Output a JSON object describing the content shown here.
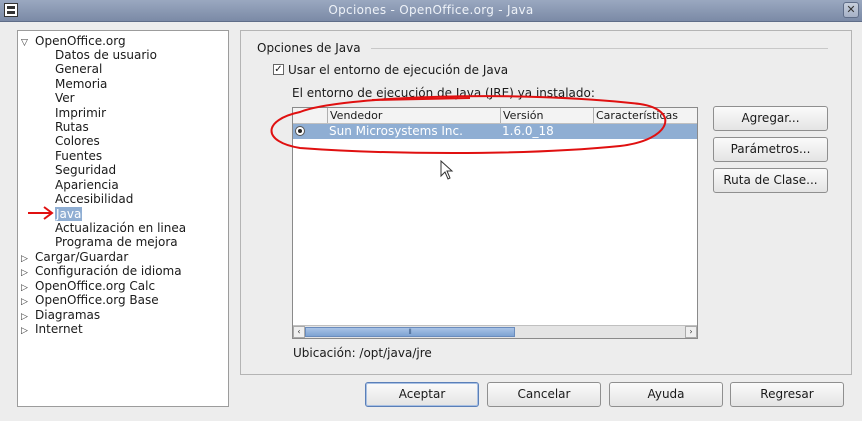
{
  "window": {
    "title": "Opciones - OpenOffice.org - Java",
    "close_glyph": "✕"
  },
  "tree": {
    "items": [
      {
        "label": "OpenOffice.org",
        "expander": "▽"
      },
      {
        "label": "Datos de usuario"
      },
      {
        "label": "General"
      },
      {
        "label": "Memoria"
      },
      {
        "label": "Ver"
      },
      {
        "label": "Imprimir"
      },
      {
        "label": "Rutas"
      },
      {
        "label": "Colores"
      },
      {
        "label": "Fuentes"
      },
      {
        "label": "Seguridad"
      },
      {
        "label": "Apariencia"
      },
      {
        "label": "Accesibilidad"
      },
      {
        "label": "Java",
        "selected": true
      },
      {
        "label": "Actualización en linea"
      },
      {
        "label": "Programa de mejora"
      },
      {
        "label": "Cargar/Guardar",
        "expander": "▷"
      },
      {
        "label": "Configuración de idioma",
        "expander": "▷"
      },
      {
        "label": "OpenOffice.org Calc",
        "expander": "▷"
      },
      {
        "label": "OpenOffice.org Base",
        "expander": "▷"
      },
      {
        "label": "Diagramas",
        "expander": "▷"
      },
      {
        "label": "Internet",
        "expander": "▷"
      }
    ]
  },
  "java": {
    "group_title": "Opciones de Java",
    "use_jre_label": "Usar el entorno de ejecución de Java",
    "use_jre_checked": true,
    "check_glyph": "✓",
    "installed_label": "El entorno de ejecución de Java (JRE) ya instalado:",
    "columns": [
      "Vendedor",
      "Versión",
      "Características"
    ],
    "rows": [
      {
        "vendor": "Sun Microsystems Inc.",
        "version": "1.6.0_18",
        "features": ""
      }
    ],
    "scroll_left": "‹",
    "scroll_right": "›",
    "scroll_grip": "⦀",
    "location_label": "Ubicación: /opt/java/jre"
  },
  "side_buttons": {
    "add": "Agregar...",
    "params": "Parámetros...",
    "classpath": "Ruta de Clase..."
  },
  "footer": {
    "ok": "Aceptar",
    "cancel": "Cancelar",
    "help": "Ayuda",
    "back": "Regresar"
  },
  "colors": {
    "selection": "#8faed3",
    "annotation": "#e01010"
  }
}
